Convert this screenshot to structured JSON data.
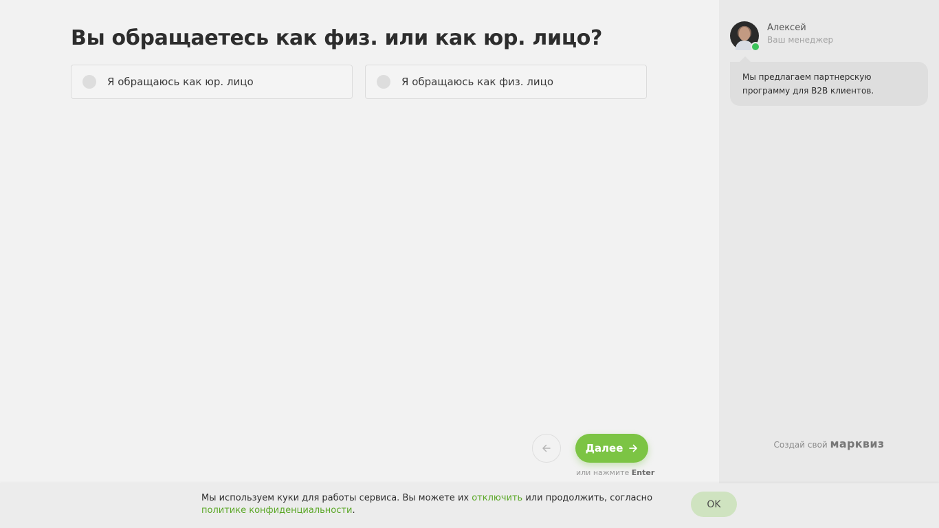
{
  "question": {
    "title": "Вы обращаетесь как физ. или как юр. лицо?",
    "options": [
      {
        "label": "Я обращаюсь как юр. лицо",
        "selected": false
      },
      {
        "label": "Я обращаюсь как физ. лицо",
        "selected": false
      }
    ]
  },
  "navigation": {
    "back_icon": "arrow-left-icon",
    "next_label": "Далее",
    "next_icon": "arrow-right-icon",
    "hint_prefix": "или нажмите",
    "hint_key": "Enter"
  },
  "sidebar": {
    "manager_name": "Алексей",
    "manager_role": "Ваш менеджер",
    "status": "online",
    "message": "Мы предлагаем партнерскую программу для B2B клиентов.",
    "create_prefix": "Создай свой",
    "brand": "марквиз"
  },
  "cookie": {
    "text_before": "Мы используем куки для работы сервиса. Вы можете их ",
    "link_disable": "отключить",
    "text_middle": " или продолжить, согласно ",
    "link_policy": "политике конфиденциальности",
    "text_after": ".",
    "ok_label": "OK"
  },
  "colors": {
    "accent": "#7cc444",
    "link": "#5aa726",
    "online": "#3cc35a"
  }
}
